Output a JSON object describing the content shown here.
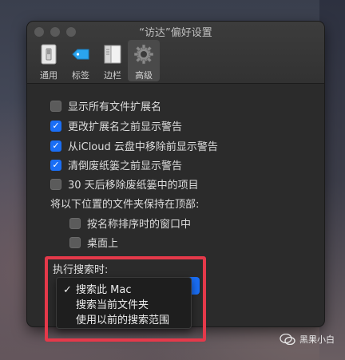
{
  "window": {
    "title": "“访达”偏好设置"
  },
  "toolbar": {
    "items": [
      {
        "label": "通用",
        "icon": "general-switch-icon",
        "active": false
      },
      {
        "label": "标签",
        "icon": "tag-icon",
        "active": false
      },
      {
        "label": "边栏",
        "icon": "sidebar-icon",
        "active": false
      },
      {
        "label": "高级",
        "icon": "gear-icon",
        "active": true
      }
    ]
  },
  "options": [
    {
      "label": "显示所有文件扩展名",
      "checked": false
    },
    {
      "label": "更改扩展名之前显示警告",
      "checked": true
    },
    {
      "label": "从iCloud 云盘中移除前显示警告",
      "checked": true
    },
    {
      "label": "清倒废纸篓之前显示警告",
      "checked": true
    },
    {
      "label": "30 天后移除废纸篓中的项目",
      "checked": false
    }
  ],
  "folders_top": {
    "heading": "将以下位置的文件夹保持在顶部:",
    "options": [
      {
        "label": "按名称排序时的窗口中",
        "checked": false
      },
      {
        "label": "桌面上",
        "checked": false
      }
    ]
  },
  "search": {
    "heading": "执行搜索时:",
    "menu": [
      {
        "label": "搜索此 Mac",
        "selected": true,
        "check": "✓"
      },
      {
        "label": "搜索当前文件夹",
        "selected": false,
        "check": ""
      },
      {
        "label": "使用以前的搜索范围",
        "selected": false,
        "check": ""
      }
    ]
  },
  "watermark": {
    "text": "黑果小白"
  },
  "colors": {
    "accent": "#1a6ef5",
    "highlight": "#e5394a"
  }
}
